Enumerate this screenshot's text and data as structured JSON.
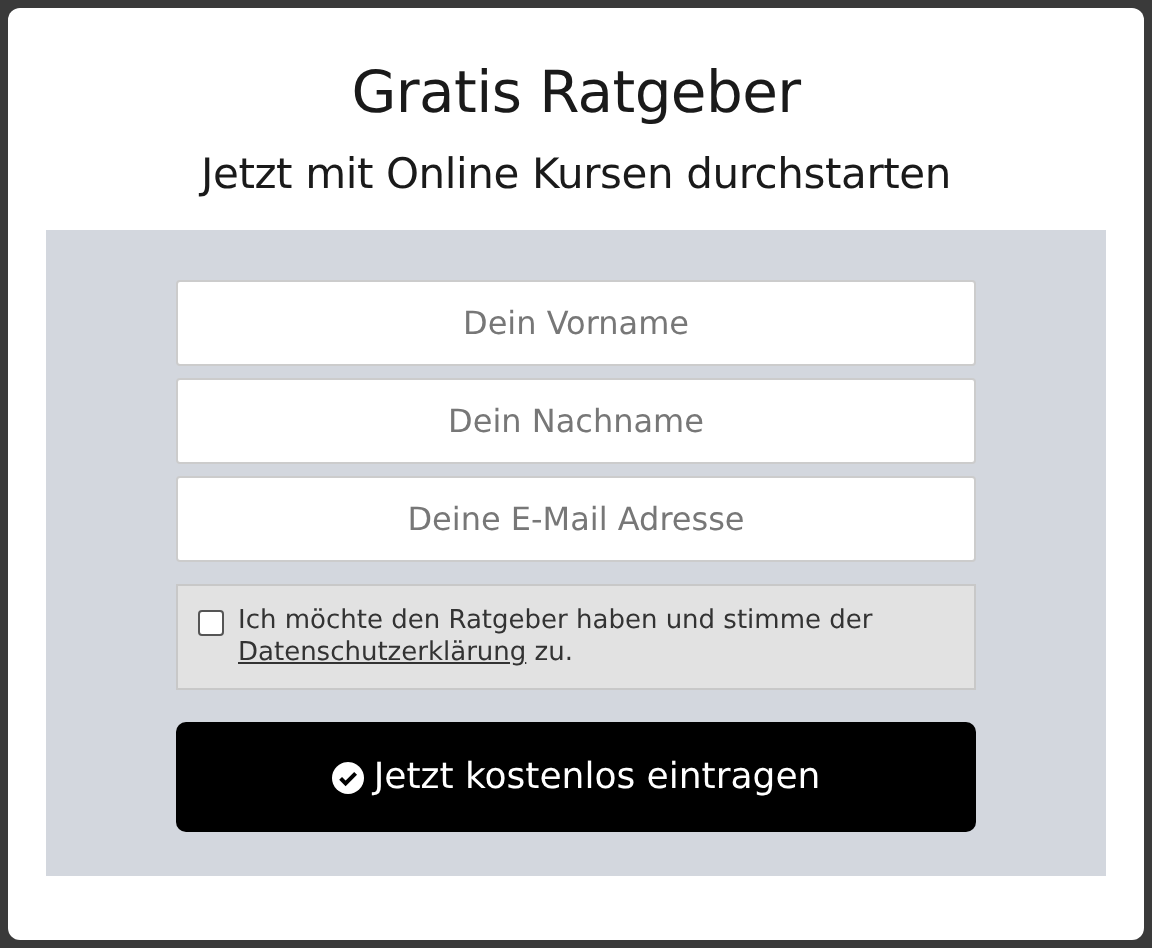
{
  "title": "Gratis Ratgeber",
  "subtitle": "Jetzt mit Online Kursen durchstarten",
  "fields": [
    {
      "placeholder": "Dein Vorname"
    },
    {
      "placeholder": "Dein Nachname"
    },
    {
      "placeholder": "Deine E-Mail Adresse"
    }
  ],
  "consent": {
    "checked": false,
    "text_before": "Ich möchte den Ratgeber haben und stimme der ",
    "link": "Datenschutzerklärung",
    "text_after": " zu."
  },
  "submit_button": {
    "label": "Jetzt kostenlos eintragen"
  }
}
